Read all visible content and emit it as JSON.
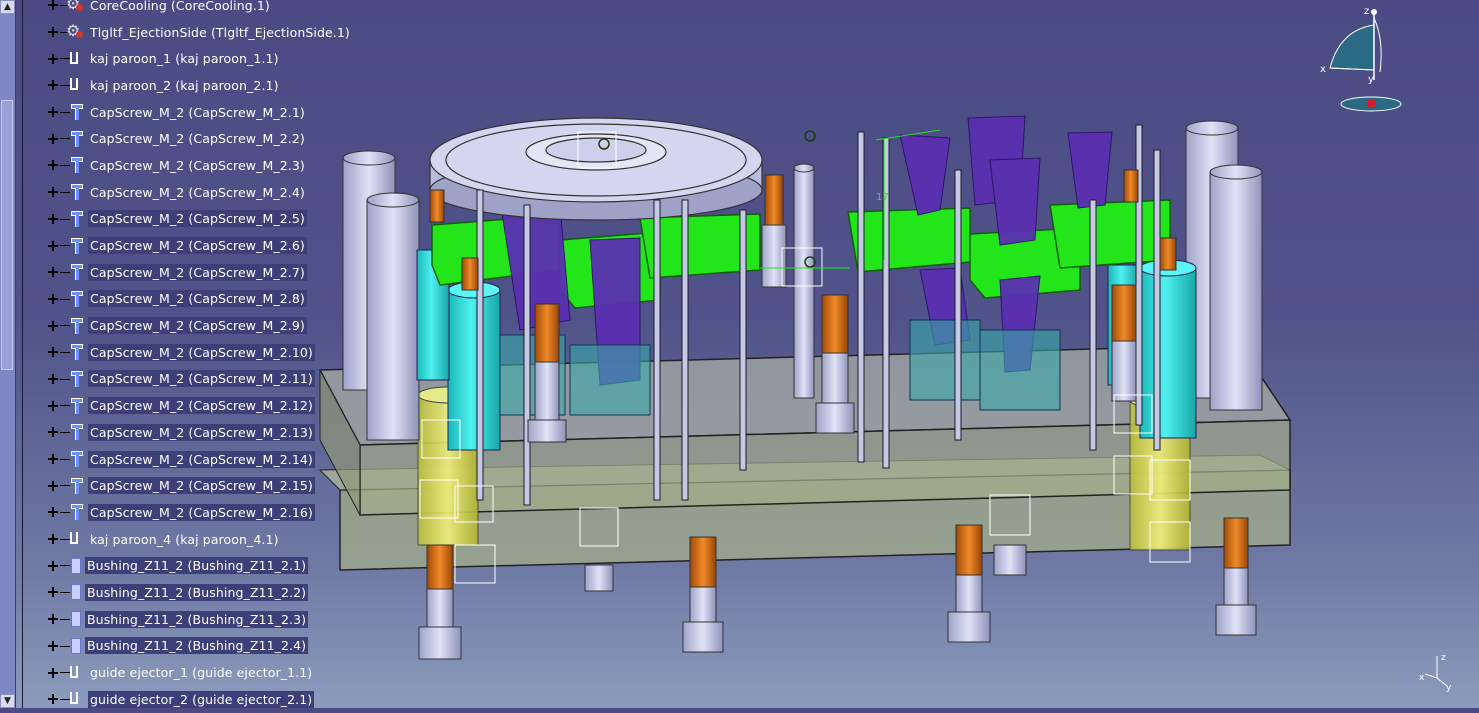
{
  "tree": {
    "items": [
      {
        "label": "CoreCooling (CoreCooling.1)",
        "icon": "gear-icon",
        "highlight": false
      },
      {
        "label": "Tlgltf_EjectionSide (Tlgltf_EjectionSide.1)",
        "icon": "gear-icon",
        "highlight": false
      },
      {
        "label": "kaj paroon_1 (kaj paroon_1.1)",
        "icon": "part-icon",
        "highlight": false
      },
      {
        "label": "kaj paroon_2 (kaj paroon_2.1)",
        "icon": "part-icon",
        "highlight": false
      },
      {
        "label": "CapScrew_M_2 (CapScrew_M_2.1)",
        "icon": "screw-icon",
        "highlight": false
      },
      {
        "label": "CapScrew_M_2 (CapScrew_M_2.2)",
        "icon": "screw-icon",
        "highlight": false
      },
      {
        "label": "CapScrew_M_2 (CapScrew_M_2.3)",
        "icon": "screw-icon",
        "highlight": false
      },
      {
        "label": "CapScrew_M_2 (CapScrew_M_2.4)",
        "icon": "screw-icon",
        "highlight": false
      },
      {
        "label": "CapScrew_M_2 (CapScrew_M_2.5)",
        "icon": "screw-icon",
        "highlight": true
      },
      {
        "label": "CapScrew_M_2 (CapScrew_M_2.6)",
        "icon": "screw-icon",
        "highlight": true
      },
      {
        "label": "CapScrew_M_2 (CapScrew_M_2.7)",
        "icon": "screw-icon",
        "highlight": true
      },
      {
        "label": "CapScrew_M_2 (CapScrew_M_2.8)",
        "icon": "screw-icon",
        "highlight": true
      },
      {
        "label": "CapScrew_M_2 (CapScrew_M_2.9)",
        "icon": "screw-icon",
        "highlight": true
      },
      {
        "label": "CapScrew_M_2 (CapScrew_M_2.10)",
        "icon": "screw-icon",
        "highlight": true
      },
      {
        "label": "CapScrew_M_2 (CapScrew_M_2.11)",
        "icon": "screw-icon",
        "highlight": true
      },
      {
        "label": "CapScrew_M_2 (CapScrew_M_2.12)",
        "icon": "screw-icon",
        "highlight": true
      },
      {
        "label": "CapScrew_M_2 (CapScrew_M_2.13)",
        "icon": "screw-icon",
        "highlight": true
      },
      {
        "label": "CapScrew_M_2 (CapScrew_M_2.14)",
        "icon": "screw-icon",
        "highlight": true
      },
      {
        "label": "CapScrew_M_2 (CapScrew_M_2.15)",
        "icon": "screw-icon",
        "highlight": true
      },
      {
        "label": "CapScrew_M_2 (CapScrew_M_2.16)",
        "icon": "screw-icon",
        "highlight": true
      },
      {
        "label": "kaj paroon_4 (kaj paroon_4.1)",
        "icon": "part-icon",
        "highlight": false
      },
      {
        "label": "Bushing_Z11_2 (Bushing_Z11_2.1)",
        "icon": "bushing-icon",
        "highlight": true
      },
      {
        "label": "Bushing_Z11_2 (Bushing_Z11_2.2)",
        "icon": "bushing-icon",
        "highlight": true
      },
      {
        "label": "Bushing_Z11_2 (Bushing_Z11_2.3)",
        "icon": "bushing-icon",
        "highlight": true
      },
      {
        "label": "Bushing_Z11_2 (Bushing_Z11_2.4)",
        "icon": "bushing-icon",
        "highlight": true
      },
      {
        "label": "guide ejector_1 (guide ejector_1.1)",
        "icon": "part-icon",
        "highlight": false
      },
      {
        "label": "guide ejector_2 (guide ejector_2.1)",
        "icon": "part-icon",
        "highlight": true
      }
    ]
  },
  "compass": {
    "x": "x",
    "y": "y",
    "z": "z"
  },
  "axes_small": {
    "x": "x",
    "y": "y",
    "z": "z"
  },
  "dimension_label": "17",
  "colors": {
    "background_top": "#4a4b84",
    "background_bottom": "#8c9bbd",
    "plate": "#a8b6a8",
    "green": "#22e61a",
    "cyan": "#26d4d4",
    "orange": "#d86a10",
    "purple": "#5d2fb6",
    "steel": "#c2c6e6"
  }
}
